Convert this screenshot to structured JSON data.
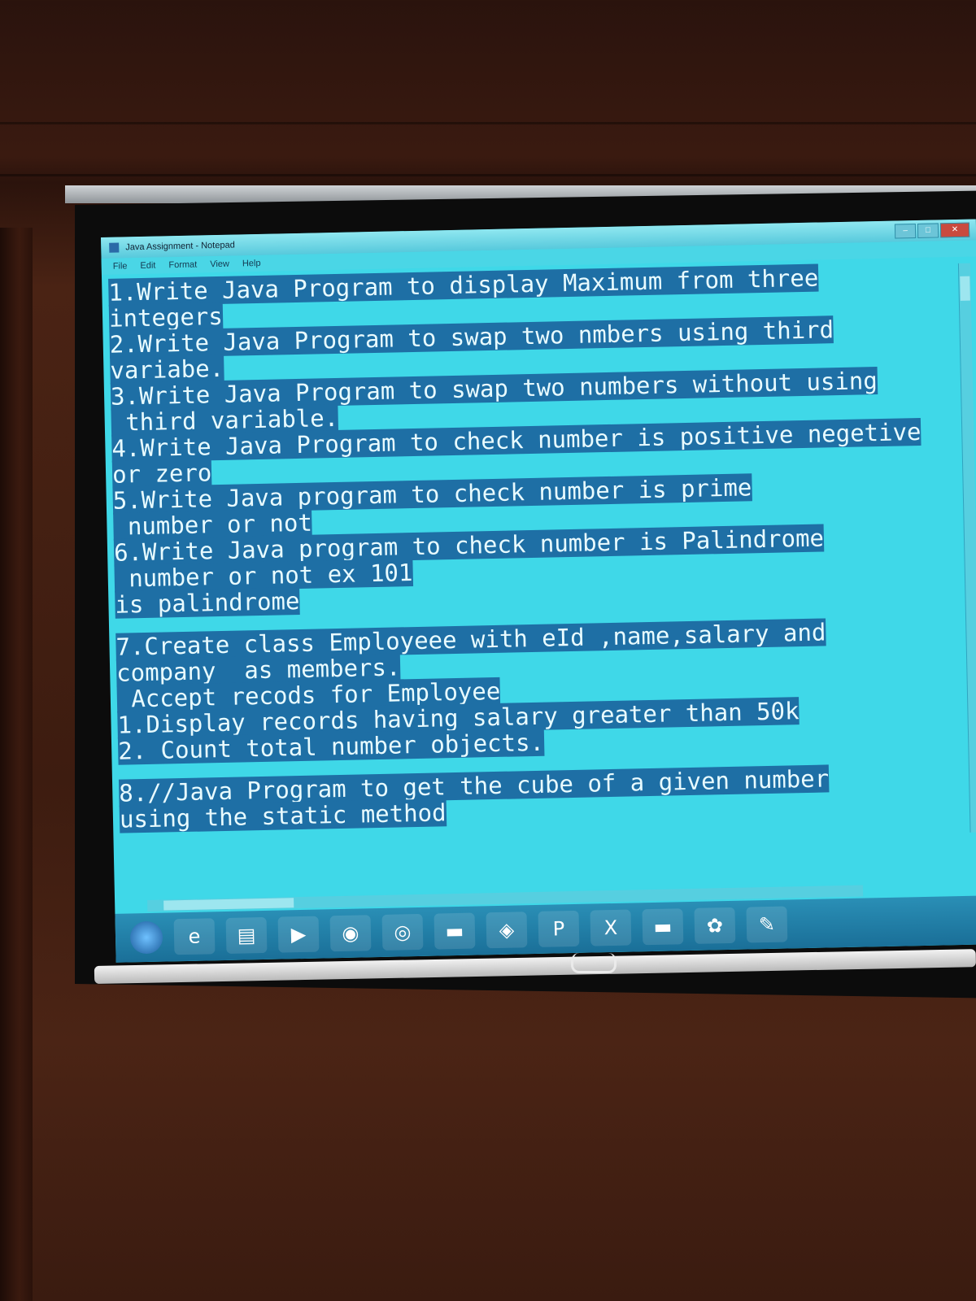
{
  "window": {
    "title": "Java Assignment - Notepad",
    "controls": [
      "–",
      "□",
      "✕"
    ]
  },
  "menu": [
    "File",
    "Edit",
    "Format",
    "View",
    "Help"
  ],
  "document_lines": [
    "1.Write Java Program to display Maximum from three",
    "integers",
    "2.Write Java Program to swap two nmbers using third",
    "variabe.",
    "3.Write Java Program to swap two numbers without using",
    " third variable.",
    "4.Write Java Program to check number is positive negetive",
    "or zero",
    "5.Write Java program to check number is prime",
    " number or not",
    "6.Write Java program to check number is Palindrome",
    " number or not ex 101",
    "is palindrome",
    "",
    "7.Create class Employeee with eId ,name,salary and",
    "company  as members.",
    " Accept recods for Employee",
    "1.Display records having salary greater than 50k",
    "2. Count total number objects.",
    "",
    "8.//Java Program to get the cube of a given number",
    "using the static method"
  ],
  "taskbar": {
    "icons": [
      "start-orb",
      "ie-icon",
      "folder-icon",
      "media-player-icon",
      "firefox-icon",
      "chrome-icon",
      "app-icon",
      "app2-icon",
      "publisher-icon",
      "excel-icon",
      "app3-icon",
      "paint-icon",
      "notepad-icon"
    ],
    "icon_glyphs": [
      "",
      "e",
      "▤",
      "▶",
      "◉",
      "◎",
      "▬",
      "◈",
      "P",
      "X",
      "▬",
      "✿",
      "✎"
    ]
  },
  "colors": {
    "screen_bg": "#3fd8e8",
    "selection": "#1e6fa5"
  }
}
